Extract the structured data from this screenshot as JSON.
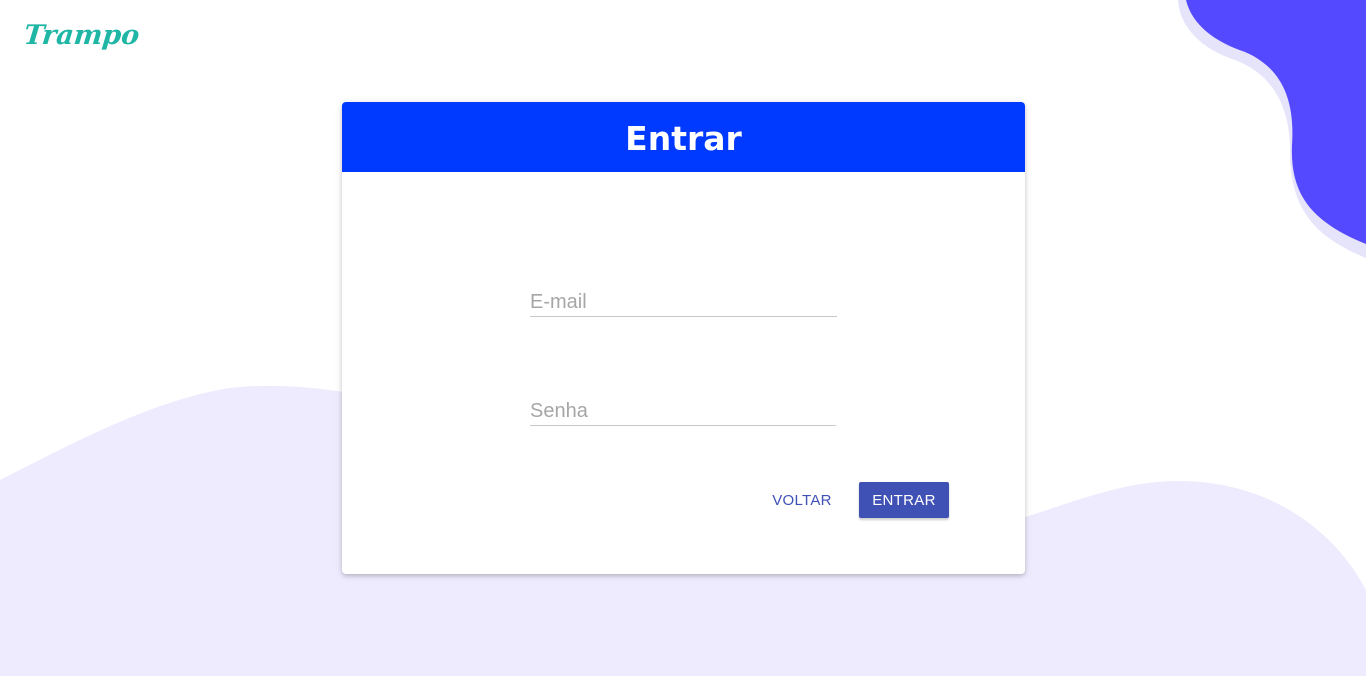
{
  "brand": {
    "logo_text": "Trampo",
    "logo_color": "#1fb6a5"
  },
  "colors": {
    "header": "#0039ff",
    "primary_button": "#3f51b5",
    "blob": "#5449ff",
    "blob_shadow": "#e6e4fb",
    "wave": "#edebfd"
  },
  "login": {
    "title": "Entrar",
    "email_placeholder": "E-mail",
    "email_value": "",
    "password_placeholder": "Senha",
    "password_value": "",
    "back_label": "VOLTAR",
    "submit_label": "ENTRAR"
  }
}
